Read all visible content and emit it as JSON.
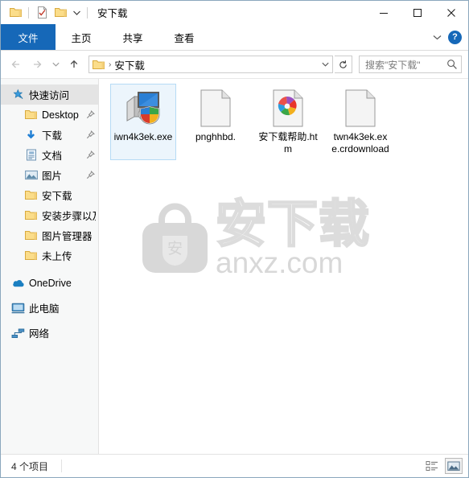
{
  "window": {
    "title": "安下载",
    "quick_access_toolbar": [
      {
        "name": "folder-properties-icon",
        "tooltip": "属性"
      },
      {
        "name": "new-folder-icon",
        "tooltip": "新建文件夹"
      },
      {
        "name": "customize-qat-caret-icon",
        "tooltip": "自定义快速访问工具栏"
      }
    ],
    "controls": {
      "minimize": "─",
      "maximize": "☐",
      "close": "✕"
    }
  },
  "ribbon": {
    "tabs": [
      {
        "label": "文件",
        "active": true
      },
      {
        "label": "主页",
        "active": false
      },
      {
        "label": "共享",
        "active": false
      },
      {
        "label": "查看",
        "active": false
      }
    ],
    "collapse_icon": "chevron-down-icon",
    "help_label": "?",
    "accent_color": "#1668b8"
  },
  "address_bar": {
    "back_label": "←",
    "forward_label": "→",
    "recent_label": "⌄",
    "up_label": "↑",
    "breadcrumb_separator": "›",
    "path": "安下载",
    "dropdown_label": "⌄",
    "refresh_label": "↻"
  },
  "search": {
    "placeholder": "搜索\"安下载\"",
    "icon": "search-icon"
  },
  "sidebar": {
    "items": [
      {
        "label": "快速访问",
        "icon": "star-pin-icon",
        "level": 0,
        "selected": true,
        "pinned": false
      },
      {
        "label": "Desktop",
        "icon": "folder-icon",
        "level": 1,
        "selected": false,
        "pinned": true
      },
      {
        "label": "下载",
        "icon": "downloads-icon",
        "level": 1,
        "selected": false,
        "pinned": true
      },
      {
        "label": "文档",
        "icon": "documents-icon",
        "level": 1,
        "selected": false,
        "pinned": true
      },
      {
        "label": "图片",
        "icon": "pictures-icon",
        "level": 1,
        "selected": false,
        "pinned": true
      },
      {
        "label": "安下载",
        "icon": "folder-icon",
        "level": 1,
        "selected": false,
        "pinned": false
      },
      {
        "label": "安装步骤以及",
        "icon": "folder-icon",
        "level": 1,
        "selected": false,
        "pinned": false
      },
      {
        "label": "图片管理器",
        "icon": "folder-icon",
        "level": 1,
        "selected": false,
        "pinned": false
      },
      {
        "label": "未上传",
        "icon": "folder-icon",
        "level": 1,
        "selected": false,
        "pinned": false
      },
      {
        "label": "OneDrive",
        "icon": "onedrive-icon",
        "level": 0,
        "selected": false,
        "pinned": false
      },
      {
        "label": "此电脑",
        "icon": "this-pc-icon",
        "level": 0,
        "selected": false,
        "pinned": false
      },
      {
        "label": "网络",
        "icon": "network-icon",
        "level": 0,
        "selected": false,
        "pinned": false
      }
    ]
  },
  "files": [
    {
      "label": "iwn4k3ek.exe",
      "icon": "executable-installer-icon",
      "selected": true
    },
    {
      "label": "pnghhbd.",
      "icon": "blank-document-icon",
      "selected": false
    },
    {
      "label": "安下载帮助.htm",
      "icon": "html-browser-icon",
      "selected": false
    },
    {
      "label": "twn4k3ek.exe.crdownload",
      "icon": "blank-document-icon",
      "selected": false
    }
  ],
  "watermark": {
    "text_cn": "安下载",
    "text_en": "anxz.com",
    "bag_glyph": "安",
    "color": "#d8d8d8"
  },
  "status_bar": {
    "item_count_label": "4 个项目",
    "views": [
      {
        "name": "details-view-icon",
        "active": false
      },
      {
        "name": "large-icons-view-icon",
        "active": true
      }
    ]
  }
}
